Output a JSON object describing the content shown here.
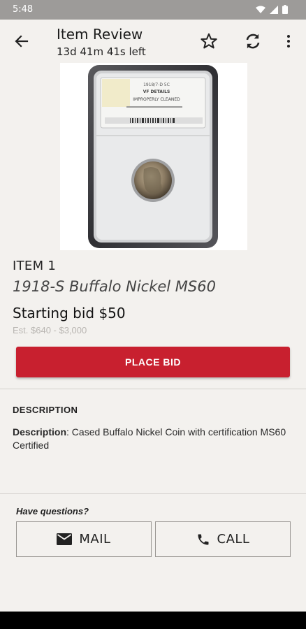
{
  "status_bar": {
    "time": "5:48"
  },
  "app_bar": {
    "title": "Item Review",
    "subtitle": "13d 41m 41s left",
    "icons": [
      "back-arrow-icon",
      "star-outline-icon",
      "refresh-icon",
      "more-vertical-icon"
    ]
  },
  "coin_slab": {
    "label_line1": "1918/7-D 5C",
    "label_line2": "VF DETAILS",
    "label_line3": "IMPROPERLY CLEANED"
  },
  "item": {
    "number": "ITEM 1",
    "title": "1918-S Buffalo Nickel MS60",
    "starting_bid": "Starting bid $50",
    "estimate": "Est. $640 - $3,000"
  },
  "actions": {
    "place_bid": "PLACE BID"
  },
  "description": {
    "heading": "DESCRIPTION",
    "label": "Description",
    "text": ": Cased Buffalo Nickel Coin with certification MS60 Certified"
  },
  "contact": {
    "prompt": "Have questions?",
    "mail_label": "MAIL",
    "call_label": "CALL"
  },
  "colors": {
    "accent": "#c8202f",
    "background": "#f3f1ee",
    "status_bar": "#9d9b99"
  }
}
